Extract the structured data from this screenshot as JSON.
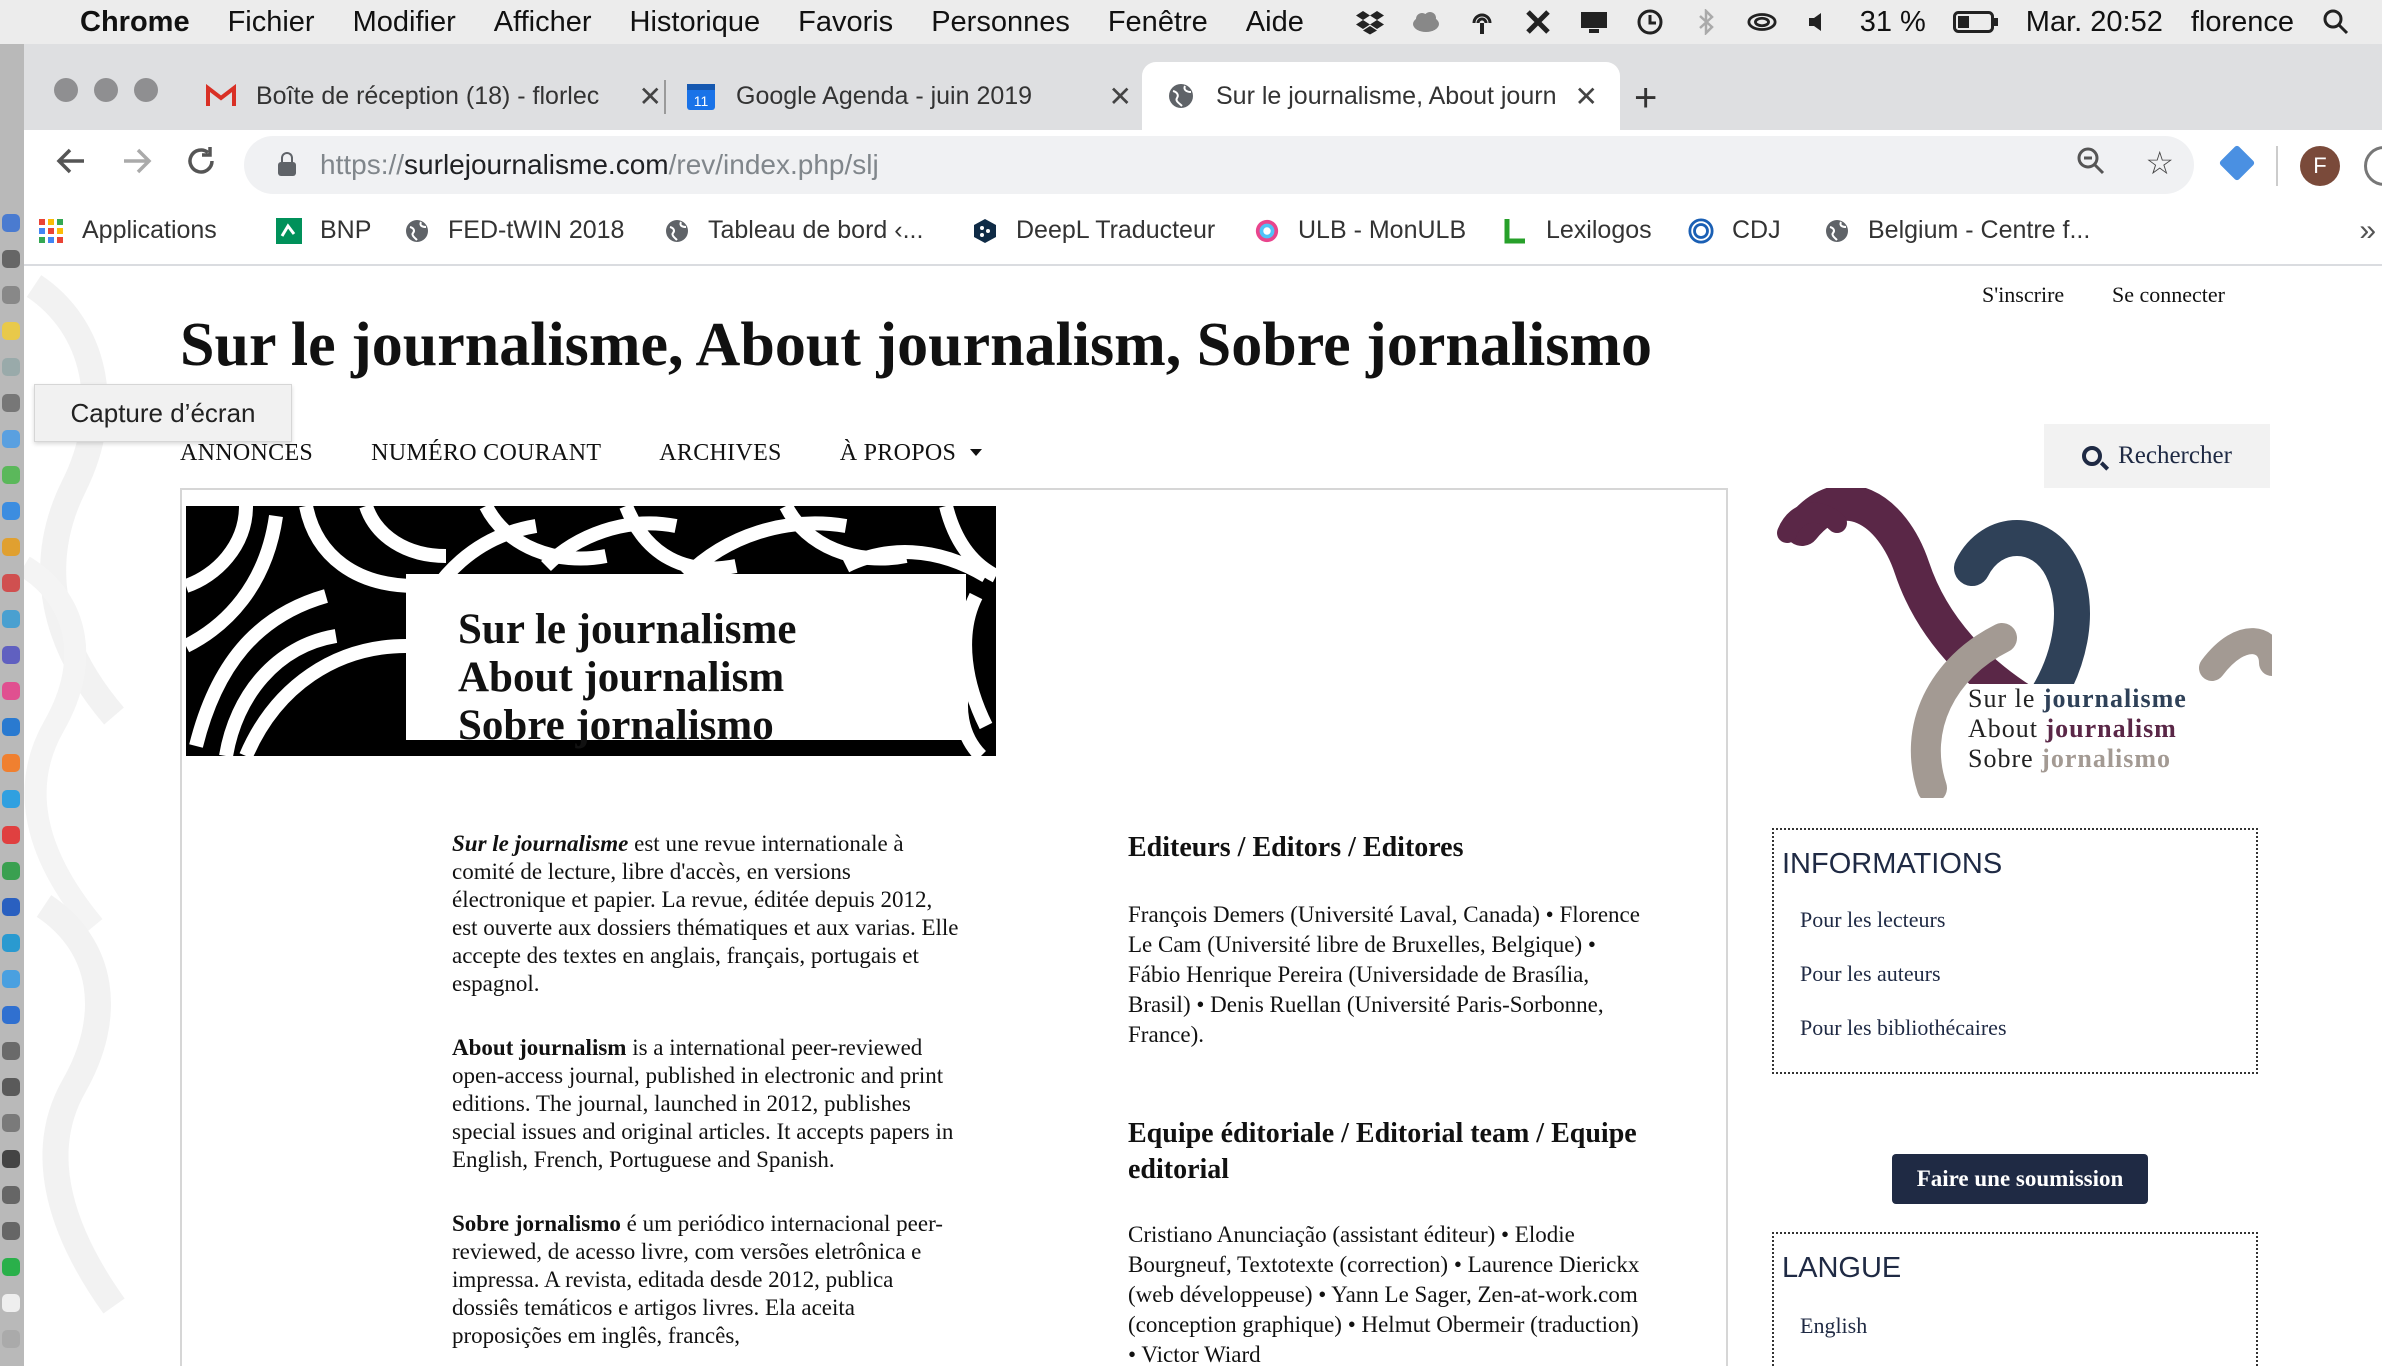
{
  "menubar": {
    "app": "Chrome",
    "items": [
      "Fichier",
      "Modifier",
      "Afficher",
      "Historique",
      "Favoris",
      "Personnes",
      "Fenêtre",
      "Aide"
    ],
    "battery": "31 %",
    "clock": "Mar. 20:52",
    "user": "florence"
  },
  "tabs": [
    {
      "title": "Boîte de réception (18) - florlec",
      "icon": "gmail-icon"
    },
    {
      "title": "Google Agenda - juin 2019",
      "icon": "calendar-icon",
      "badge": "11"
    },
    {
      "title": "Sur le journalisme, About journ",
      "icon": "globe-icon",
      "active": true
    }
  ],
  "omnibox": {
    "scheme": "https://",
    "host": "surlejournalisme.com",
    "path": "/rev/index.php/slj"
  },
  "profile_initial": "F",
  "bookmarks": [
    "Applications",
    "BNP",
    "FED-tWIN 2018",
    "Tableau de bord ‹...",
    "DeepL Traducteur",
    "ULB - MonULB",
    "Lexilogos",
    "CDJ",
    "Belgium - Centre f..."
  ],
  "bookmarks_more": "»",
  "tooltip": "Capture d’écran",
  "site": {
    "signup": "S'inscrire",
    "login": "Se connecter",
    "title": "Sur le journalisme, About journalism, Sobre jornalismo",
    "nav": [
      "ANNONCES",
      "NUMÉRO COURANT",
      "ARCHIVES",
      "À PROPOS"
    ],
    "search": "Rechercher",
    "banner_lines": [
      "Sur le journalisme",
      "About journalism",
      "Sobre jornalismo"
    ]
  },
  "intro": [
    {
      "lead": "Sur le journalisme",
      "text": " est une revue internationale à comité de lecture, libre d'accès, en versions électronique et papier. La revue, éditée depuis 2012, est ouverte aux dossiers thématiques et aux varias. Elle accepte des textes en anglais, français, portugais et espagnol."
    },
    {
      "lead": "About journalism",
      "text": " is a international peer-reviewed open-access journal, published in electronic and print editions. The journal, launched in 2012, publishes special issues and original articles. It accepts papers in English, French, Portuguese and Spanish."
    },
    {
      "lead": "Sobre jornalismo",
      "text": " é um periódico internacional peer-reviewed, de acesso livre, com versões eletrônica e impressa. A revista, editada desde 2012, publica dossiês temáticos e artigos livres. Ela aceita proposições em inglês, francês,"
    }
  ],
  "editors": {
    "heading": "Editeurs / Editors / Editores",
    "text": "François Demers (Université Laval, Canada) • Florence Le Cam (Université libre de Bruxelles, Belgique) • Fábio Henrique Pereira (Universidade de Brasília, Brasil) • Denis Ruellan (Université Paris-Sorbonne, France)."
  },
  "team": {
    "heading": "Equipe éditoriale / Editorial team / Equipe editorial",
    "text": "Cristiano Anunciação (assistant éditeur) • Elodie Bourgneuf, Textotexte (correction) • Laurence Dierickx (web développeuse) • Yann Le Sager, Zen-at-work.com (conception graphique) • Helmut Obermeir (traduction) • Victor Wiard"
  },
  "logo_text": [
    {
      "a": "Sur le ",
      "b": "journalisme"
    },
    {
      "a": "About ",
      "b": "journalism"
    },
    {
      "a": "Sobre ",
      "b": "jornalismo"
    }
  ],
  "information": {
    "heading": "INFORMATIONS",
    "links": [
      "Pour les lecteurs",
      "Pour les auteurs",
      "Pour les bibliothécaires"
    ]
  },
  "submit": "Faire une soumission",
  "language": {
    "heading": "LANGUE",
    "links": [
      "English"
    ]
  },
  "colors": {
    "navy": "#1f2a44",
    "plum": "#5a2747",
    "slate": "#2f4158",
    "taupe": "#a39a93"
  }
}
